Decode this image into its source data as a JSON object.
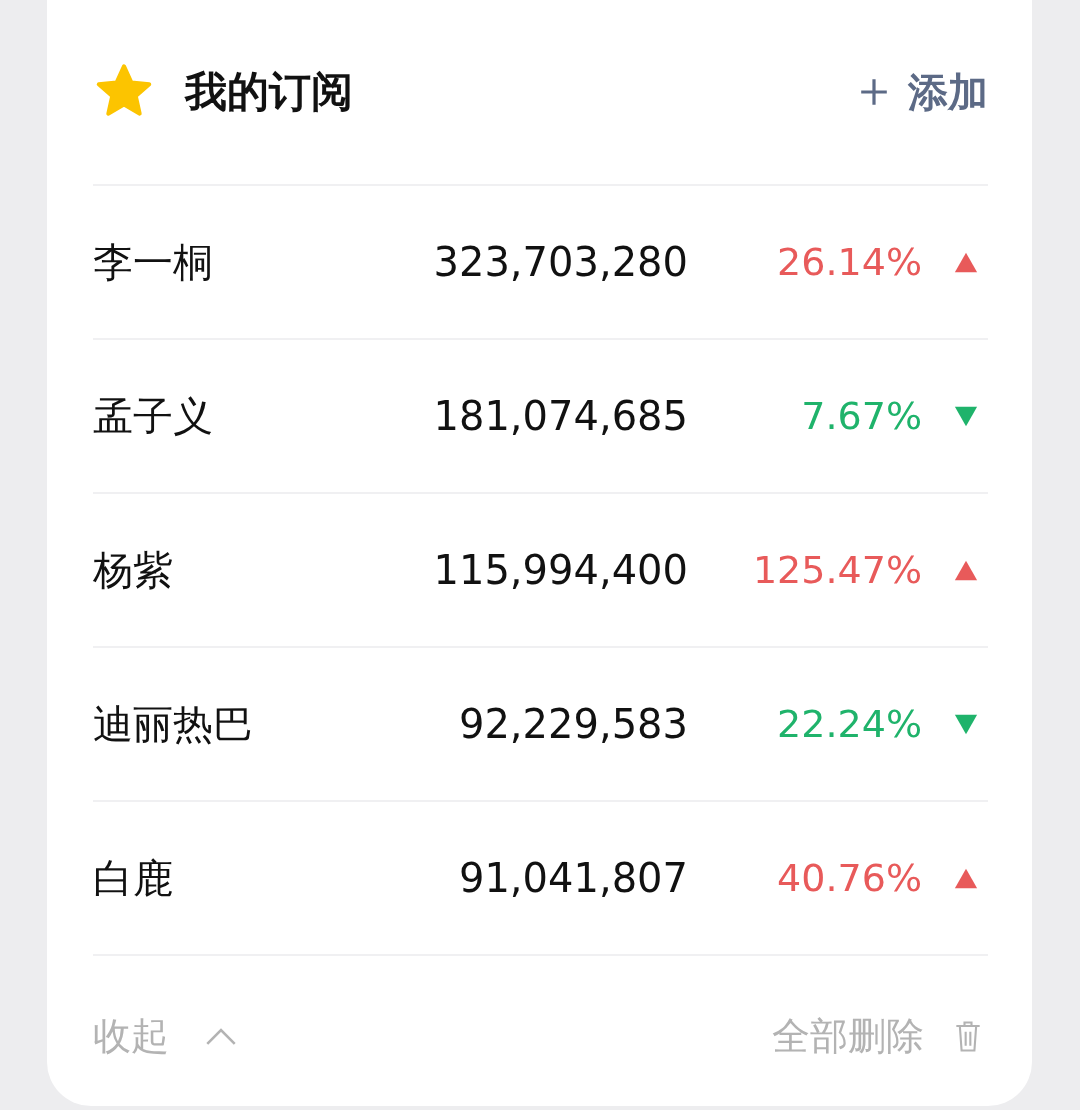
{
  "header": {
    "title": "我的订阅",
    "add_button": "添加"
  },
  "rows": [
    {
      "name": "李一桐",
      "value": "323,703,280",
      "change": "26.14%",
      "kind": "up"
    },
    {
      "name": "孟子义",
      "value": "181,074,685",
      "change": "7.67%",
      "kind": "down"
    },
    {
      "name": "杨紫",
      "value": "115,994,400",
      "change": "125.47%",
      "kind": "up"
    },
    {
      "name": "迪丽热巴",
      "value": "92,229,583",
      "change": "22.24%",
      "kind": "down"
    },
    {
      "name": "白鹿",
      "value": "91,041,807",
      "change": "40.76%",
      "kind": "up"
    }
  ],
  "footer": {
    "collapse": "收起",
    "delete_all": "全部删除"
  }
}
